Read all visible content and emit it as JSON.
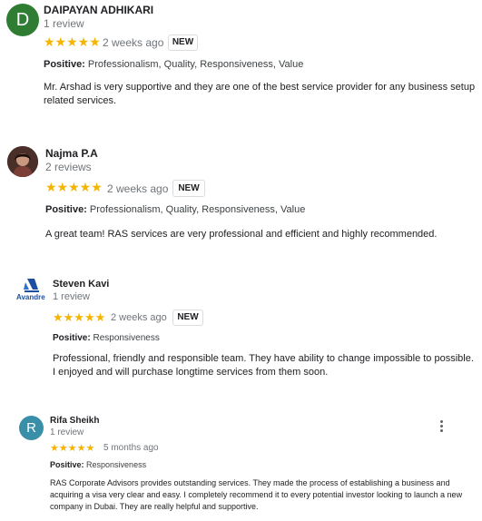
{
  "reviews": [
    {
      "avatar_letter": "D",
      "avatar_color": "#2e7d32",
      "name": "DAIPAYAN ADHIKARI",
      "count": "1 review",
      "stars": "★★★★★",
      "time": "2 weeks ago",
      "badge": "NEW",
      "positive_label": "Positive:",
      "positive_value": "Professionalism, Quality, Responsiveness, Value",
      "text": "Mr. Arshad is very supportive and they are one of the best service provider for any business setup related services."
    },
    {
      "avatar_color": "#6d4c41",
      "name": "Najma P.A",
      "count": "2 reviews",
      "stars": "★★★★★",
      "time": "2 weeks ago",
      "badge": "NEW",
      "positive_label": "Positive:",
      "positive_value": "Professionalism, Quality, Responsiveness, Value",
      "text": "A great team! RAS services are very professional and efficient and highly recommended."
    },
    {
      "avatar_logo_text": "Avandre",
      "name": "Steven Kavi",
      "count": "1 review",
      "stars": "★★★★★",
      "time": "2 weeks ago",
      "badge": "NEW",
      "positive_label": "Positive:",
      "positive_value": "Responsiveness",
      "text": "Professional, friendly and responsible team. They have ability to change impossible to possible. I enjoyed and will purchase longtime services from them soon."
    },
    {
      "avatar_letter": "R",
      "avatar_color": "#3a8fa8",
      "name": "Rifa Sheikh",
      "count": "1 review",
      "stars": "★★★★★",
      "time": "5 months ago",
      "positive_label": "Positive:",
      "positive_value": "Responsiveness",
      "text": "RAS Corporate Advisors provides outstanding services. They made the process of establishing a business and acquiring a visa very clear and easy.  I completely recommend it to every potential investor looking to launch a new company in Dubai. They are really helpful and supportive."
    }
  ],
  "colors": {
    "star": "#f4b400",
    "muted": "#70757a"
  },
  "icons": {
    "more": "more-vert-icon"
  }
}
